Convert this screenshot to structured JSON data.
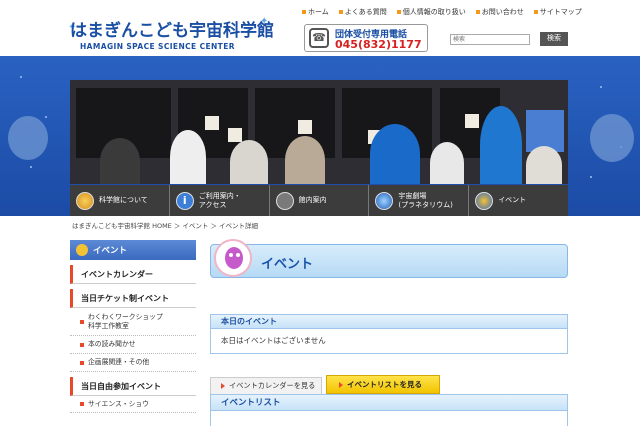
{
  "header": {
    "logo_ja": "はまぎんこども宇宙科学館",
    "logo_en": "HAMAGIN SPACE SCIENCE CENTER",
    "util_nav": [
      "ホーム",
      "よくある質問",
      "個人情報の取り扱い",
      "お問い合わせ",
      "サイトマップ"
    ],
    "tel_label": "団体受付専用電話",
    "tel_number": "045(832)1177",
    "search_placeholder": "検索",
    "search_button": "検索"
  },
  "main_nav": [
    {
      "label": "科学館について",
      "icon": "planet-icon"
    },
    {
      "label": "ご利用案内・\nアクセス",
      "icon": "info-icon"
    },
    {
      "label": "館内案内",
      "icon": "floor-map-icon"
    },
    {
      "label": "宇宙劇場\n(プラネタリウム)",
      "icon": "planetarium-icon"
    },
    {
      "label": "イベント",
      "icon": "event-icon"
    }
  ],
  "breadcrumb": "はまぎんこども宇宙科学館 HOME ＞ イベント ＞ イベント詳細",
  "sidebar": {
    "title": "イベント",
    "items": [
      {
        "label": "イベントカレンダー",
        "type": "main"
      },
      {
        "label": "当日チケット制イベント",
        "type": "main"
      },
      {
        "label": "わくわくワークショップ\n科学工作教室",
        "type": "sub"
      },
      {
        "label": "本の読み聞かせ",
        "type": "sub"
      },
      {
        "label": "企画展関連・その他",
        "type": "sub"
      },
      {
        "label": "当日自由参加イベント",
        "type": "main"
      },
      {
        "label": "サイエンス・ショウ",
        "type": "sub"
      }
    ]
  },
  "content": {
    "page_title": "イベント",
    "today_head": "本日のイベント",
    "today_body": "本日はイベントはございません",
    "tab_calendar": "イベントカレンダーを見る",
    "tab_list": "イベントリストを見る",
    "list_head": "イベントリスト"
  },
  "colors": {
    "brand_blue": "#1a4fa3",
    "hero_blue": "#2a62c2",
    "accent_red": "#e74a2a",
    "tab_yellow": "#f2c300",
    "tel_red": "#d82020"
  }
}
